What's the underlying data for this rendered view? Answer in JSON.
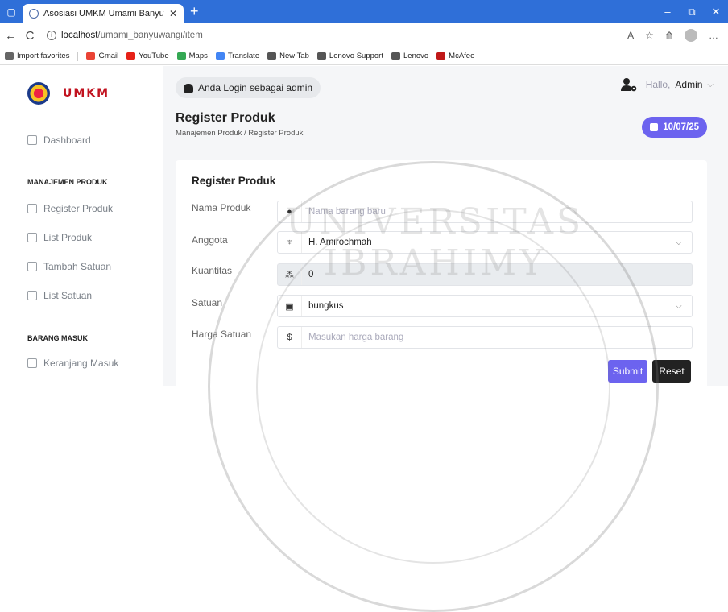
{
  "browser": {
    "tab_title": "Asosiasi UMKM Umami Banyuwa",
    "tab_close": "✕",
    "new_tab": "+",
    "window_controls": [
      "–",
      "⧉",
      "✕"
    ],
    "nav": [
      "←",
      "C"
    ],
    "url_host": "localhost",
    "url_path": "/umami_banyuwangi/item",
    "addr_icons": [
      "A",
      "☆",
      "⟰",
      "●",
      "…"
    ],
    "bookmarks": [
      {
        "label": "Import favorites",
        "color": "#666"
      },
      {
        "label": "Gmail",
        "color": "#ea4335"
      },
      {
        "label": "YouTube",
        "color": "#e62117"
      },
      {
        "label": "Maps",
        "color": "#34a853"
      },
      {
        "label": "Translate",
        "color": "#4285f4"
      },
      {
        "label": "New Tab",
        "color": "#555"
      },
      {
        "label": "Lenovo Support",
        "color": "#555"
      },
      {
        "label": "Lenovo",
        "color": "#555"
      },
      {
        "label": "McAfee",
        "color": "#c01818"
      }
    ]
  },
  "sidebar": {
    "logo_text": "UMKM",
    "dashboard": "Dashboard",
    "section_produk": "MANAJEMEN PRODUK",
    "items_produk": [
      "Register Produk",
      "List Produk",
      "Tambah Satuan",
      "List Satuan"
    ],
    "section_masuk": "BARANG MASUK",
    "items_masuk": [
      "Keranjang Masuk"
    ]
  },
  "header": {
    "login_text": "Anda Login sebagai admin",
    "hello_prefix": "Hallo,",
    "hello_name": "Admin",
    "chevron": "⌵"
  },
  "page": {
    "title": "Register Produk",
    "breadcrumb": "Manajemen Produk / Register Produk",
    "date": "10/07/25"
  },
  "form": {
    "title": "Register Produk",
    "labels": [
      "Nama Produk",
      "Anggota",
      "Kuantitas",
      "Satuan",
      "Harga Satuan"
    ],
    "nama_placeholder": "Nama barang baru",
    "anggota_value": "H. Amirochmah",
    "kuantitas_value": "0",
    "satuan_value": "bungkus",
    "harga_placeholder": "Masukan harga barang",
    "submit": "Submit",
    "reset": "Reset"
  },
  "watermark_text": "UNIVERSITAS IBRAHIMY",
  "colors": {
    "accent": "#6c63ef",
    "titlebar": "#2f6fd8",
    "logo": "#c1121f"
  }
}
